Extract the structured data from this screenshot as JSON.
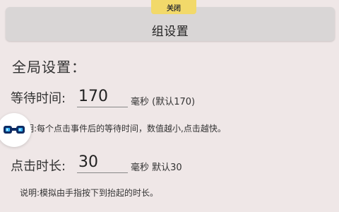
{
  "header": {
    "close_tab_label": "关闭",
    "title": "组设置"
  },
  "global_settings": {
    "title": "全局设置："
  },
  "wait_time": {
    "label": "等待时间:",
    "value": "170",
    "unit": "毫秒 (默认170)",
    "note": "明:每个点击事件后的等待时间，数值越小,点击越快。"
  },
  "click_duration": {
    "label": "点击时长:",
    "value": "30",
    "unit": "毫秒 默认30",
    "note": "说明:模拟由手指按下到抬起的时长。"
  },
  "icons": {
    "floating_button": "binoculars-icon"
  },
  "colors": {
    "background": "#efe7e7",
    "title_bar": "#d9d6d6",
    "close_tab": "#f2d96a",
    "icon": "#0e2b63"
  }
}
